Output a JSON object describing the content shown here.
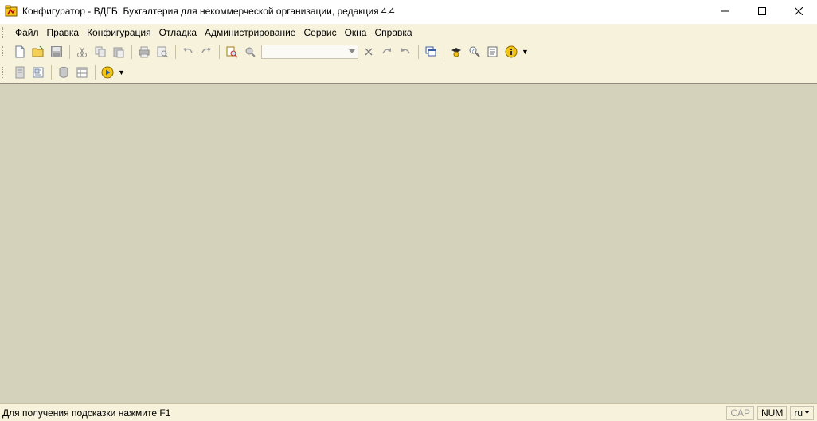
{
  "window": {
    "title": "Конфигуратор - ВДГБ: Бухгалтерия для некоммерческой организации, редакция 4.4"
  },
  "menu": {
    "items": [
      {
        "u": "Ф",
        "rest": "айл"
      },
      {
        "u": "П",
        "rest": "равка"
      },
      {
        "u": "",
        "rest": "Конфигурация"
      },
      {
        "u": "",
        "rest": "Отладка"
      },
      {
        "u": "",
        "rest": "Администрирование"
      },
      {
        "u": "С",
        "rest": "ервис"
      },
      {
        "u": "О",
        "rest": "кна"
      },
      {
        "u": "С",
        "rest": "правка"
      }
    ]
  },
  "toolbar": {
    "search": {
      "value": ""
    }
  },
  "status": {
    "hint": "Для получения подсказки нажмите F1",
    "cap": "CAP",
    "num": "NUM",
    "lang": "ru"
  },
  "colors": {
    "workarea": "#d5d2bc",
    "bars": "#f7f2dc"
  }
}
